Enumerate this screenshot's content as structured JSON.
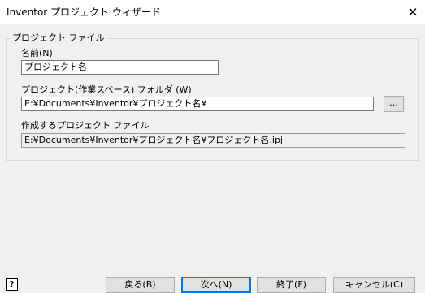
{
  "window": {
    "title": "Inventor プロジェクト ウィザード",
    "close_glyph": "✕"
  },
  "group": {
    "legend": "プロジェクト ファイル"
  },
  "fields": {
    "name_label": "名前(N)",
    "name_value": "プロジェクト名",
    "folder_label": "プロジェクト(作業スペース) フォルダ (W)",
    "folder_value": "E:¥Documents¥Inventor¥プロジェクト名¥",
    "browse_label": "…",
    "file_label": "作成するプロジェクト ファイル",
    "file_value": "E:¥Documents¥Inventor¥プロジェクト名¥プロジェクト名.ipj"
  },
  "footer": {
    "help_glyph": "?",
    "back_label": "戻る(B)",
    "next_label": "次へ(N)",
    "finish_label": "終了(F)",
    "cancel_label": "キャンセル(C)"
  },
  "colors": {
    "window_bg": "#f0f0f0",
    "titlebar_bg": "#ffffff",
    "default_button_border": "#0078d7"
  }
}
